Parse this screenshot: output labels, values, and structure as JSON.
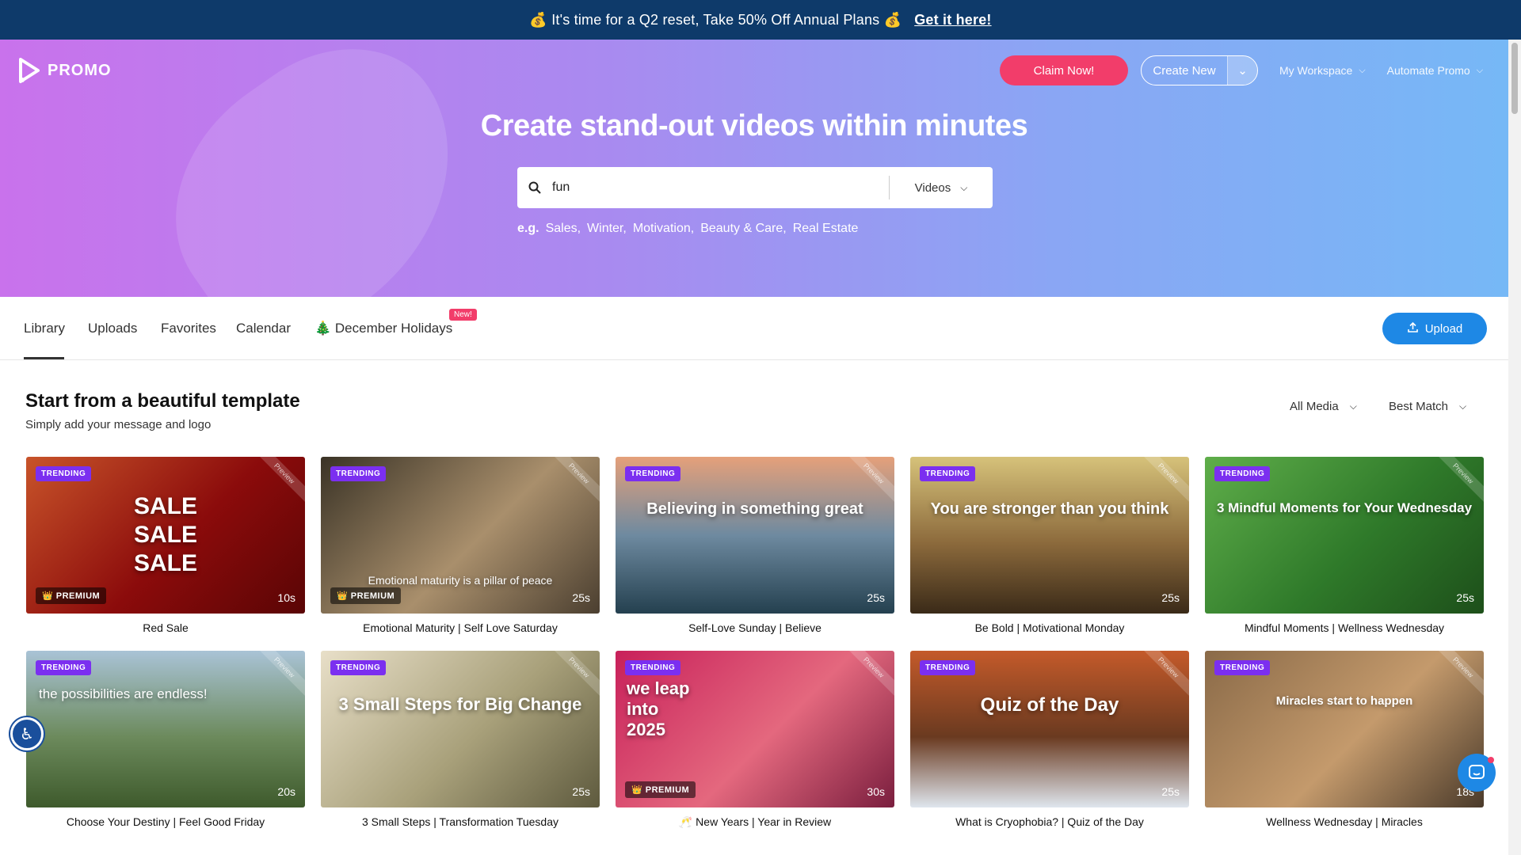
{
  "promo_bar": {
    "text": "💰 It's time for a Q2 reset, Take 50% Off Annual Plans 💰",
    "cta": "Get it here!"
  },
  "logo": {
    "text": "PROMO"
  },
  "nav": {
    "claim": "Claim Now!",
    "create": "Create New",
    "workspace": "My Workspace",
    "automate": "Automate Promo"
  },
  "hero": {
    "title": "Create stand-out videos within minutes",
    "search_value": "fun",
    "search_type": "Videos",
    "eg_label": "e.g.",
    "examples": [
      "Sales,",
      "Winter,",
      "Motivation,",
      "Beauty & Care,",
      "Real Estate"
    ]
  },
  "tabs": {
    "library": "Library",
    "uploads": "Uploads",
    "favorites": "Favorites",
    "calendar": "Calendar",
    "december": "🎄 December Holidays",
    "new_badge": "New!",
    "upload_btn": "Upload"
  },
  "section": {
    "title": "Start from a beautiful template",
    "subtitle": "Simply add your message and logo",
    "filter_media": "All Media",
    "filter_sort": "Best Match"
  },
  "cards": [
    {
      "title": "Red Sale",
      "duration": "10s",
      "trending": "TRENDING",
      "premium": "👑 PREMIUM",
      "overlay": "SALE\nSALE\nSALE",
      "preview": "Preview",
      "bg": "linear-gradient(135deg,#c8542a,#8b0b0b 55%,#5a0505)"
    },
    {
      "title": "Emotional Maturity | Self Love Saturday",
      "duration": "25s",
      "trending": "TRENDING",
      "premium": "👑 PREMIUM",
      "overlay": "Emotional maturity is a pillar of peace",
      "preview": "Preview",
      "bg": "linear-gradient(135deg,#3a3326,#a98f6c 55%,#4b3f30)"
    },
    {
      "title": "Self-Love Sunday | Believe",
      "duration": "25s",
      "trending": "TRENDING",
      "premium": "",
      "overlay": "Believing in something great",
      "preview": "Preview",
      "bg": "linear-gradient(180deg,#e5a07a,#6e8aa0 50%,#24404f)"
    },
    {
      "title": "Be Bold | Motivational Monday",
      "duration": "25s",
      "trending": "TRENDING",
      "premium": "",
      "overlay": "You are stronger than you think",
      "preview": "Preview",
      "bg": "linear-gradient(180deg,#d6c27a,#8c6a3c 55%,#3a2a18)"
    },
    {
      "title": "Mindful Moments | Wellness Wednesday",
      "duration": "25s",
      "trending": "TRENDING",
      "premium": "",
      "overlay": "3 Mindful Moments for Your Wednesday",
      "preview": "Preview",
      "bg": "linear-gradient(135deg,#5fae4a,#2f7a2a 55%,#1d4f1a)"
    },
    {
      "title": "Choose Your Destiny | Feel Good Friday",
      "duration": "20s",
      "trending": "TRENDING",
      "premium": "",
      "overlay": "the possibilities are endless!",
      "preview": "Preview",
      "bg": "linear-gradient(180deg,#a9c3d6,#6c8a5c 55%,#3e5a2c)"
    },
    {
      "title": "3 Small Steps | Transformation Tuesday",
      "duration": "25s",
      "trending": "TRENDING",
      "premium": "",
      "overlay": "3 Small Steps for Big Change",
      "preview": "Preview",
      "bg": "linear-gradient(135deg,#e8dfc8,#a8a07a 55%,#5e5a3e)"
    },
    {
      "title": "🥂 New Years | Year in Review",
      "duration": "30s",
      "trending": "TRENDING",
      "premium": "👑 PREMIUM",
      "overlay": "we leap into 2025",
      "preview": "Preview",
      "bg": "linear-gradient(135deg,#c8205a,#e4687e 55%,#7a1e3e)"
    },
    {
      "title": "What is Cryophobia? | Quiz of the Day",
      "duration": "25s",
      "trending": "TRENDING",
      "premium": "",
      "overlay": "Quiz of the Day",
      "preview": "Preview",
      "bg": "linear-gradient(180deg,#c45a2a,#6a3a20 55%,#dfe6ee)"
    },
    {
      "title": "Wellness Wednesday | Miracles",
      "duration": "18s",
      "trending": "TRENDING",
      "premium": "",
      "overlay": "Miracles start to happen",
      "preview": "Preview",
      "bg": "linear-gradient(135deg,#8a6a48,#c49a6c 55%,#4a3a2a)"
    }
  ],
  "icons": {
    "search": "search-icon",
    "upload": "upload-icon",
    "accessibility": "accessibility-icon",
    "chat": "chat-icon"
  },
  "colors": {
    "accent": "#7b2ff0",
    "claim": "#f23d6a",
    "upload": "#1e88e5",
    "topbar": "#0e3a6a"
  }
}
